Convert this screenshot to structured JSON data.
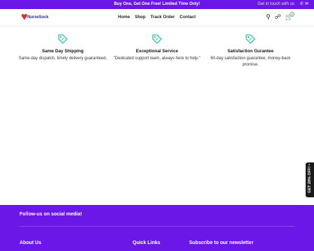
{
  "announcement": {
    "text": "Buy One, Get One Free! Limited Time Only!",
    "contact_label": "Get in touch with us"
  },
  "header": {
    "logo_text": "NurseSock",
    "nav": [
      "Home",
      "Shop",
      "Track Order",
      "Contact"
    ],
    "cart_count": "0"
  },
  "features": [
    {
      "icon": "tag-icon",
      "title": "Same Day Shipping",
      "description": "Same-day dispatch, timely delivery guaranteed."
    },
    {
      "icon": "tag-icon",
      "title": "Exceptional Service",
      "description": "\"Dedicated support team, always here to help.\""
    },
    {
      "icon": "tag-icon",
      "title": "Satisfaction Gurantee",
      "description": "60-day satisfaction guarantee, money-back promise."
    }
  ],
  "side_tab": {
    "label": "GET 20% OFF! •"
  },
  "footer": {
    "follow_label": "Follow-us on social media!",
    "columns": [
      "About Us",
      "Quick Links",
      "Subscribe to our newsletter"
    ]
  },
  "colors": {
    "brand_purple": "#6a17e8",
    "icon_teal": "#2ec4a6",
    "logo_red": "#e32730"
  }
}
